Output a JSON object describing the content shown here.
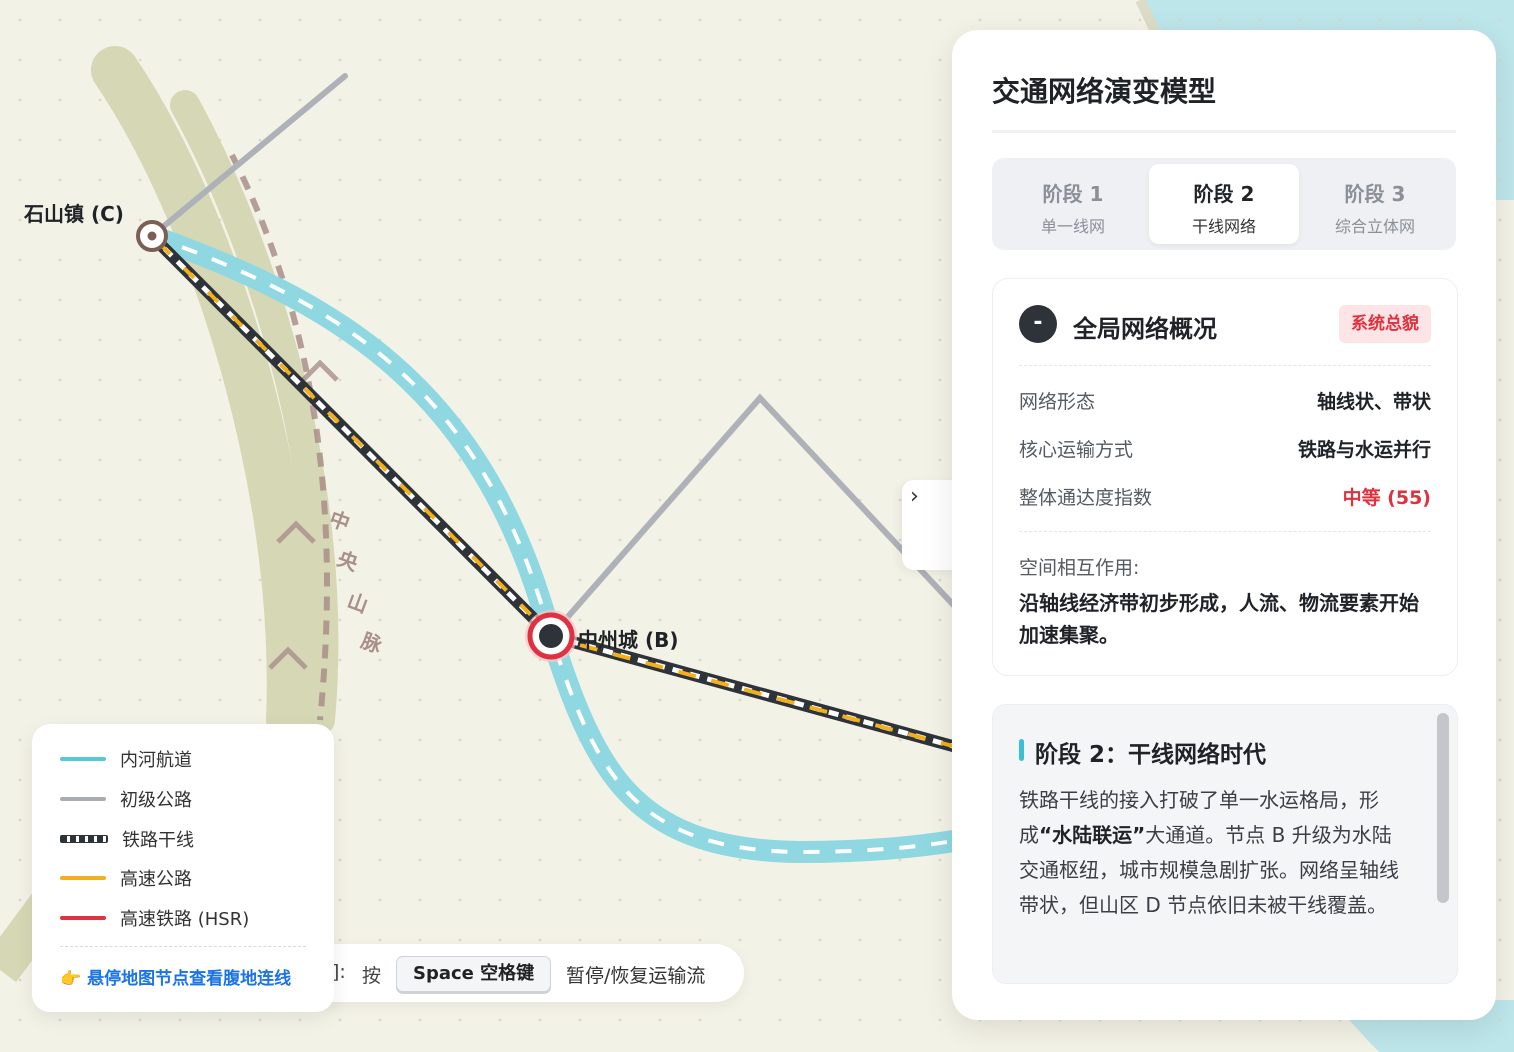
{
  "map": {
    "nodes": [
      {
        "id": "C",
        "label": "石山镇 (C)"
      },
      {
        "id": "B",
        "label": "中州城 (B)"
      }
    ],
    "mountain_label": [
      "中",
      "央",
      "山",
      "脉"
    ],
    "colors": {
      "river": "#8fd8e2",
      "road": "#aeb2b8",
      "rail": "#2d3339",
      "highway": "#f2b01e",
      "hsr": "#e03140",
      "mountain": "#d6d8b5",
      "mountain_dash": "#a98f8a",
      "sea": "#bde6ea",
      "background": "#f3f2e6"
    }
  },
  "legend": {
    "items": [
      {
        "label": "内河航道",
        "color": "#55c9da",
        "style": "solid"
      },
      {
        "label": "初级公路",
        "color": "#a9adb3",
        "style": "solid"
      },
      {
        "label": "铁路干线",
        "color": "#2d3339",
        "style": "rail"
      },
      {
        "label": "高速公路",
        "color": "#f2b01e",
        "style": "solid"
      },
      {
        "label": "高速铁路 (HSR)",
        "color": "#e03140",
        "style": "solid"
      }
    ],
    "hint": "👉 悬停地图节点查看腹地连线"
  },
  "tipbar": {
    "prefix": "]:",
    "press": "按",
    "key": "Space 空格键",
    "action": "暂停/恢复运输流"
  },
  "panel": {
    "title": "交通网络演变模型",
    "tabs": [
      {
        "label": "阶段 1",
        "sub": "单一线网",
        "active": false
      },
      {
        "label": "阶段 2",
        "sub": "干线网络",
        "active": true
      },
      {
        "label": "阶段 3",
        "sub": "综合立体网",
        "active": false
      }
    ],
    "overview": {
      "icon": "-",
      "title": "全局网络概况",
      "badge": "系统总貌",
      "rows": [
        {
          "key": "网络形态",
          "value": "轴线状、带状"
        },
        {
          "key": "核心运输方式",
          "value": "铁路与水运并行"
        },
        {
          "key": "整体通达度指数",
          "value": "中等 (55)"
        }
      ],
      "interaction_label": "空间相互作用:",
      "interaction_text": "沿轴线经济带初步形成，人流、物流要素开始加速集聚。"
    },
    "story": {
      "title": "阶段 2：干线网络时代",
      "text_1": "铁路干线的接入打破了单一水运格局，形成",
      "text_bold": "“水陆联运”",
      "text_2": "大通道。节点 B 升级为水陆交通枢纽，城市规模急剧扩张。网络呈轴线带状，但山区 D 节点依旧未被干线覆盖。"
    },
    "collapse_icon": "›"
  }
}
